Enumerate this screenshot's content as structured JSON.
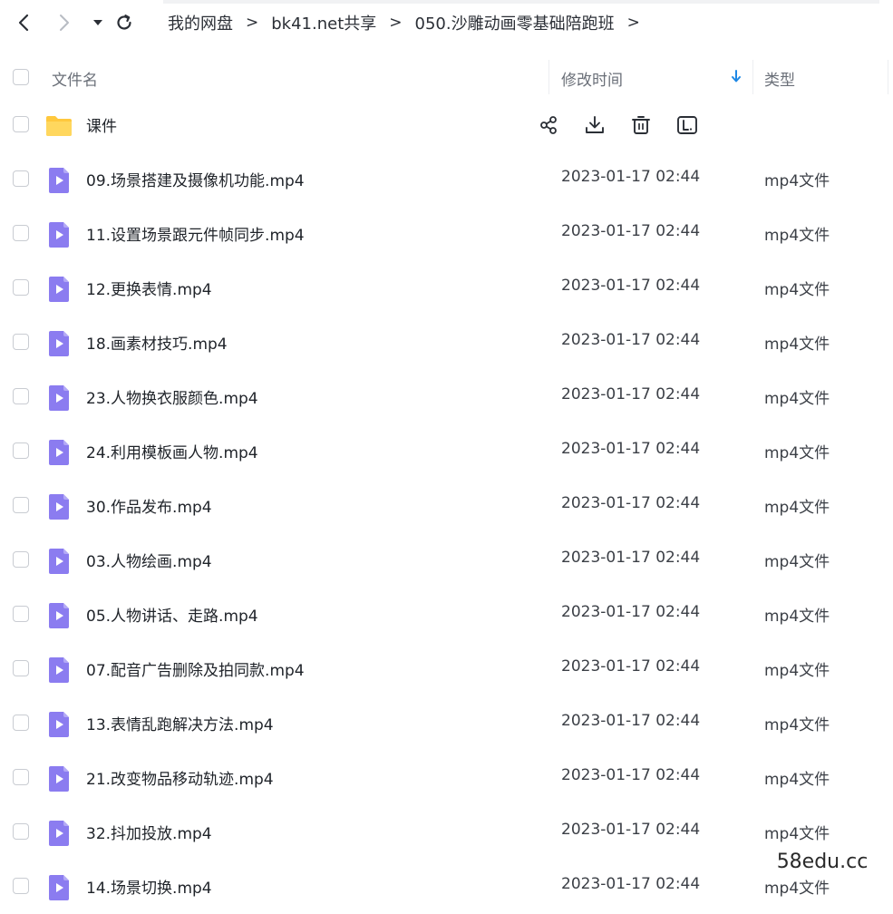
{
  "nav": {
    "back_icon": "chevron-left-icon",
    "forward_icon": "chevron-right-icon",
    "dropdown_icon": "caret-down-icon",
    "refresh_icon": "refresh-icon"
  },
  "breadcrumb": {
    "items": [
      "我的网盘",
      "bk41.net共享",
      "050.沙雕动画零基础陪跑班"
    ],
    "separator": ">"
  },
  "columns": {
    "name": "文件名",
    "modified": "修改时间",
    "type": "类型",
    "sort_icon": "arrow-down-icon",
    "sort_color": "#1e88e5"
  },
  "folder": {
    "name": "课件",
    "icon": "folder-icon",
    "color": "#ffc83d",
    "actions": [
      "share-icon",
      "download-icon",
      "delete-icon",
      "rename-icon"
    ]
  },
  "files": [
    {
      "name": "09.场景搭建及摄像机功能.mp4",
      "time": "2023-01-17 02:44",
      "type": "mp4文件"
    },
    {
      "name": "11.设置场景跟元件帧同步.mp4",
      "time": "2023-01-17 02:44",
      "type": "mp4文件"
    },
    {
      "name": "12.更换表情.mp4",
      "time": "2023-01-17 02:44",
      "type": "mp4文件"
    },
    {
      "name": "18.画素材技巧.mp4",
      "time": "2023-01-17 02:44",
      "type": "mp4文件"
    },
    {
      "name": "23.人物换衣服颜色.mp4",
      "time": "2023-01-17 02:44",
      "type": "mp4文件"
    },
    {
      "name": "24.利用模板画人物.mp4",
      "time": "2023-01-17 02:44",
      "type": "mp4文件"
    },
    {
      "name": "30.作品发布.mp4",
      "time": "2023-01-17 02:44",
      "type": "mp4文件"
    },
    {
      "name": "03.人物绘画.mp4",
      "time": "2023-01-17 02:44",
      "type": "mp4文件"
    },
    {
      "name": "05.人物讲话、走路.mp4",
      "time": "2023-01-17 02:44",
      "type": "mp4文件"
    },
    {
      "name": "07.配音广告删除及拍同款.mp4",
      "time": "2023-01-17 02:44",
      "type": "mp4文件"
    },
    {
      "name": "13.表情乱跑解决方法.mp4",
      "time": "2023-01-17 02:44",
      "type": "mp4文件"
    },
    {
      "name": "21.改变物品移动轨迹.mp4",
      "time": "2023-01-17 02:44",
      "type": "mp4文件"
    },
    {
      "name": "32.抖加投放.mp4",
      "time": "2023-01-17 02:44",
      "type": "mp4文件"
    },
    {
      "name": "14.场景切换.mp4",
      "time": "2023-01-17 02:44",
      "type": "mp4文件"
    }
  ],
  "video_icon": "video-file-icon",
  "video_icon_color": "#8b7cf0",
  "watermark": "58edu.cc"
}
